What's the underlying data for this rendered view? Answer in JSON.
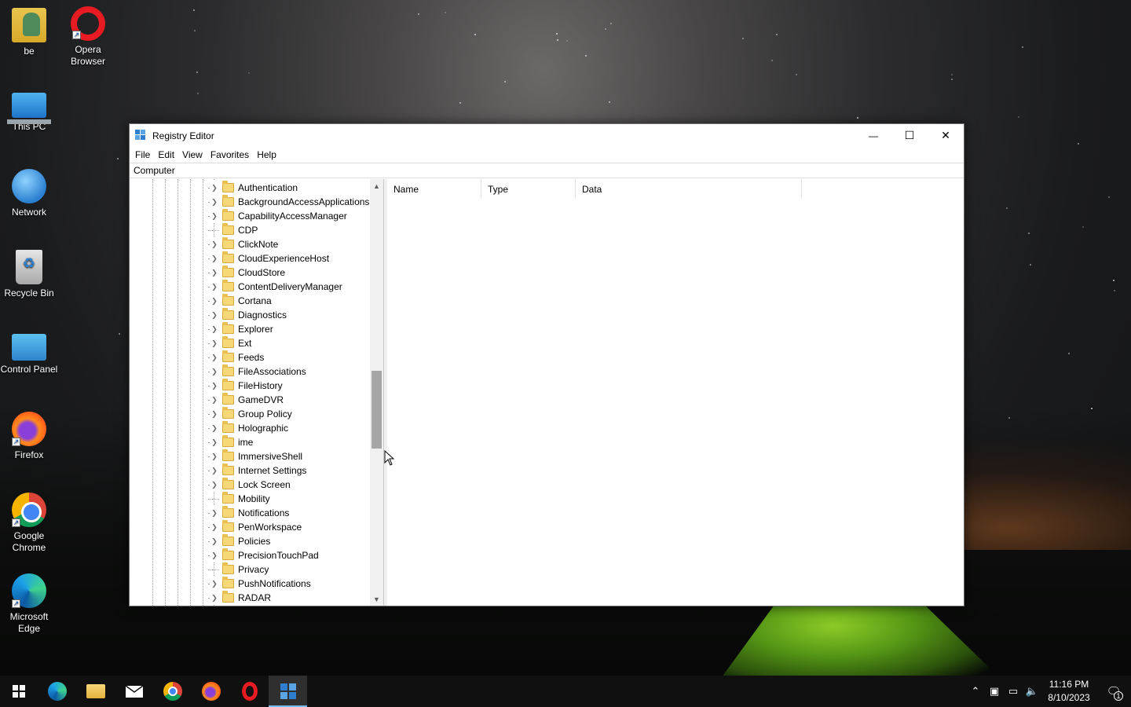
{
  "desktop": {
    "icons": [
      {
        "label": "be",
        "icon": "user-folder-icon"
      },
      {
        "label": "Opera Browser",
        "icon": "opera-icon"
      },
      {
        "label": "This PC",
        "icon": "this-pc-icon"
      },
      {
        "label": "Network",
        "icon": "network-icon"
      },
      {
        "label": "Recycle Bin",
        "icon": "recycle-bin-icon"
      },
      {
        "label": "Control Panel",
        "icon": "control-panel-icon"
      },
      {
        "label": "Firefox",
        "icon": "firefox-icon"
      },
      {
        "label": "Google Chrome",
        "icon": "chrome-icon"
      },
      {
        "label": "Microsoft Edge",
        "icon": "edge-icon"
      }
    ]
  },
  "window": {
    "title": "Registry Editor",
    "controls": {
      "minimize": "—",
      "maximize": "☐",
      "close": "✕"
    },
    "menu": [
      "File",
      "Edit",
      "View",
      "Favorites",
      "Help"
    ],
    "address": "Computer",
    "tree": [
      {
        "label": "Authentication",
        "expandable": true
      },
      {
        "label": "BackgroundAccessApplications",
        "expandable": true
      },
      {
        "label": "CapabilityAccessManager",
        "expandable": true
      },
      {
        "label": "CDP",
        "expandable": false
      },
      {
        "label": "ClickNote",
        "expandable": true
      },
      {
        "label": "CloudExperienceHost",
        "expandable": true
      },
      {
        "label": "CloudStore",
        "expandable": true
      },
      {
        "label": "ContentDeliveryManager",
        "expandable": true
      },
      {
        "label": "Cortana",
        "expandable": true
      },
      {
        "label": "Diagnostics",
        "expandable": true
      },
      {
        "label": "Explorer",
        "expandable": true
      },
      {
        "label": "Ext",
        "expandable": true
      },
      {
        "label": "Feeds",
        "expandable": true
      },
      {
        "label": "FileAssociations",
        "expandable": true
      },
      {
        "label": "FileHistory",
        "expandable": true
      },
      {
        "label": "GameDVR",
        "expandable": true
      },
      {
        "label": "Group Policy",
        "expandable": true
      },
      {
        "label": "Holographic",
        "expandable": true
      },
      {
        "label": "ime",
        "expandable": true
      },
      {
        "label": "ImmersiveShell",
        "expandable": true
      },
      {
        "label": "Internet Settings",
        "expandable": true
      },
      {
        "label": "Lock Screen",
        "expandable": true
      },
      {
        "label": "Mobility",
        "expandable": false
      },
      {
        "label": "Notifications",
        "expandable": true
      },
      {
        "label": "PenWorkspace",
        "expandable": true
      },
      {
        "label": "Policies",
        "expandable": true
      },
      {
        "label": "PrecisionTouchPad",
        "expandable": true
      },
      {
        "label": "Privacy",
        "expandable": false
      },
      {
        "label": "PushNotifications",
        "expandable": true
      },
      {
        "label": "RADAR",
        "expandable": true
      }
    ],
    "columns": [
      "Name",
      "Type",
      "Data"
    ],
    "scroll_position": 0.55
  },
  "taskbar": {
    "apps": [
      {
        "name": "edge-taskbar",
        "icon": "edge-icon",
        "active": false
      },
      {
        "name": "file-explorer-taskbar",
        "icon": "folder-icon",
        "active": false
      },
      {
        "name": "mail-taskbar",
        "icon": "mail-icon",
        "active": false
      },
      {
        "name": "chrome-taskbar",
        "icon": "chrome-icon",
        "active": false
      },
      {
        "name": "firefox-taskbar",
        "icon": "firefox-icon",
        "active": false
      },
      {
        "name": "opera-taskbar",
        "icon": "opera-icon",
        "active": false
      },
      {
        "name": "regedit-taskbar",
        "icon": "registry-editor-icon",
        "active": true
      }
    ],
    "tray": {
      "time": "11:16 PM",
      "date": "8/10/2023",
      "notification_count": "1"
    }
  },
  "colors": {
    "accent": "#76b9ed",
    "taskbar": "#101010",
    "folder": "#f7d878"
  }
}
